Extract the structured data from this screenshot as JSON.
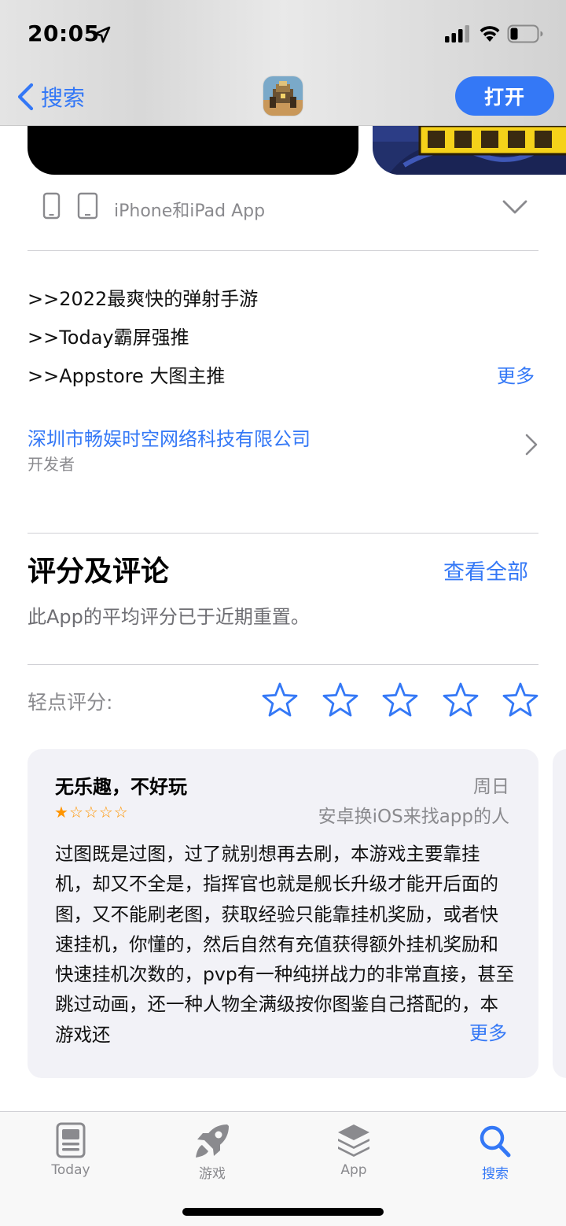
{
  "status_bar": {
    "time": "20:05",
    "icons": [
      "location-arrow-icon",
      "signal-icon",
      "wifi-icon",
      "battery-icon"
    ]
  },
  "nav": {
    "back_label": "搜索",
    "open_label": "打开"
  },
  "compatibility": {
    "label": "iPhone和iPad App",
    "icons": [
      "iphone-icon",
      "ipad-icon",
      "chevron-down-icon"
    ]
  },
  "description": {
    "lines": [
      ">>2022最爽快的弹射手游",
      ">>Today霸屏强推",
      ">>Appstore 大图主推"
    ],
    "more": "更多"
  },
  "developer": {
    "name": "深圳市畅娱时空网络科技有限公司",
    "role": "开发者"
  },
  "ratings": {
    "title": "评分及评论",
    "see_all": "查看全部",
    "note": "此App的平均评分已于近期重置。",
    "tap_to_rate": "轻点评分:",
    "tap_star_count": 5
  },
  "review": {
    "title": "无乐趣，不好玩",
    "date": "周日",
    "rating": 1,
    "max_rating": 5,
    "author": "安卓换iOS来找app的人",
    "body": "过图既是过图，过了就别想再去刷，本游戏主要靠挂机，却又不全是，指挥官也就是舰长升级才能开后面的图，又不能刷老图，获取经验只能靠挂机奖励，或者快速挂机，你懂的，然后自然有充值获得额外挂机奖励和快速挂机次数的，pvp有一种纯拼战力的非常直接，甚至跳过动画，还一种人物全满级按你图鉴自己搭配的，本游戏还",
    "more": "更多"
  },
  "tabs": [
    {
      "label": "Today",
      "icon": "today-icon",
      "active": false
    },
    {
      "label": "游戏",
      "icon": "rocket-icon",
      "active": false
    },
    {
      "label": "App",
      "icon": "app-stack-icon",
      "active": false
    },
    {
      "label": "搜索",
      "icon": "search-icon",
      "active": true
    }
  ],
  "colors": {
    "accent": "#3478f6",
    "secondary_text": "#8a8a8e",
    "star": "#ff9500",
    "card_background": "#f2f2f7"
  }
}
